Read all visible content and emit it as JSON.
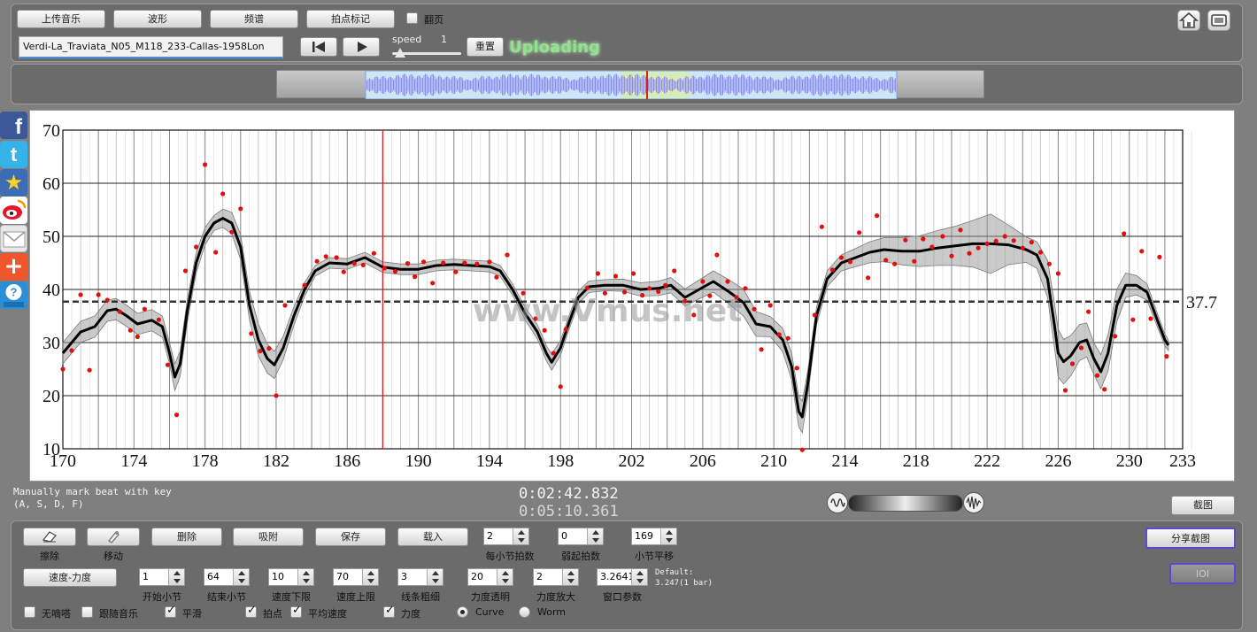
{
  "toolbar": {
    "upload_music": "上传音乐",
    "waveform": "波形",
    "spectrum": "频谱",
    "beat_mark": "拍点标记",
    "page_turn": "翻页",
    "file_name": "Verdi-La_Traviata_N05_M118_233-Callas-1958Lon",
    "speed_label": "speed",
    "speed_value": "1",
    "speed_level": 0.12,
    "reset": "重置",
    "status": "Uploading"
  },
  "overview": {
    "view_start": 0.0,
    "view_end": 1.0,
    "selection_start": 0.48,
    "selection_end": 0.61,
    "playhead": 0.53
  },
  "watermark": "www.Vmus.net",
  "chart_data": {
    "type": "line",
    "x_ticks": [
      "170",
      "174",
      "178",
      "182",
      "186",
      "190",
      "194",
      "198",
      "202",
      "206",
      "210",
      "214",
      "218",
      "222",
      "226",
      "230",
      "233"
    ],
    "y_ticks": [
      "10",
      "20",
      "30",
      "40",
      "50",
      "60",
      "70"
    ],
    "xlim": [
      170,
      233
    ],
    "ylim": [
      10,
      70
    ],
    "average": 37.7,
    "average_label": "37.7",
    "cursor_x": 188,
    "grid": true,
    "smooth_curve": [
      [
        170,
        28
      ],
      [
        170.5,
        30
      ],
      [
        171,
        32
      ],
      [
        171.8,
        33
      ],
      [
        172.5,
        36
      ],
      [
        173,
        36.3
      ],
      [
        173.6,
        35
      ],
      [
        174.2,
        33.5
      ],
      [
        175,
        34.2
      ],
      [
        175.6,
        33
      ],
      [
        176,
        28
      ],
      [
        176.3,
        23.5
      ],
      [
        176.6,
        26
      ],
      [
        177,
        36
      ],
      [
        177.5,
        45
      ],
      [
        178,
        50
      ],
      [
        178.5,
        52.5
      ],
      [
        179,
        53.4
      ],
      [
        179.5,
        52.5
      ],
      [
        180,
        48
      ],
      [
        180.5,
        37
      ],
      [
        181,
        30.5
      ],
      [
        181.5,
        27
      ],
      [
        181.9,
        25.8
      ],
      [
        182.4,
        29
      ],
      [
        183,
        35
      ],
      [
        183.6,
        40
      ],
      [
        184.2,
        43.5
      ],
      [
        185,
        45
      ],
      [
        186,
        44.8
      ],
      [
        187,
        46
      ],
      [
        188,
        44.2
      ],
      [
        189,
        43.8
      ],
      [
        190,
        43.8
      ],
      [
        191,
        44.5
      ],
      [
        192,
        44.7
      ],
      [
        193,
        44.5
      ],
      [
        194,
        44.3
      ],
      [
        194.6,
        43.5
      ],
      [
        195.3,
        40
      ],
      [
        196,
        35.5
      ],
      [
        196.7,
        32
      ],
      [
        197.2,
        28
      ],
      [
        197.5,
        26.3
      ],
      [
        198,
        29
      ],
      [
        198.5,
        34
      ],
      [
        199,
        38.5
      ],
      [
        199.6,
        40.5
      ],
      [
        200.5,
        40.8
      ],
      [
        201.5,
        40.8
      ],
      [
        202.5,
        40
      ],
      [
        203.5,
        40.2
      ],
      [
        204.2,
        40.8
      ],
      [
        205,
        38.5
      ],
      [
        205.8,
        40
      ],
      [
        206.6,
        41.5
      ],
      [
        207.5,
        39.5
      ],
      [
        208.3,
        37.5
      ],
      [
        209,
        33.5
      ],
      [
        209.8,
        33
      ],
      [
        210.5,
        30.5
      ],
      [
        211,
        25.5
      ],
      [
        211.4,
        17
      ],
      [
        211.6,
        16
      ],
      [
        211.9,
        22
      ],
      [
        212.4,
        35
      ],
      [
        213,
        42
      ],
      [
        213.8,
        45
      ],
      [
        214.6,
        46
      ],
      [
        215.4,
        47
      ],
      [
        216.2,
        47.5
      ],
      [
        217.2,
        47.2
      ],
      [
        218.2,
        47.2
      ],
      [
        219.2,
        47.8
      ],
      [
        220.2,
        48.2
      ],
      [
        221.2,
        48.6
      ],
      [
        222.2,
        48.6
      ],
      [
        223.2,
        48.4
      ],
      [
        224.2,
        47.5
      ],
      [
        224.8,
        46.5
      ],
      [
        225.4,
        42
      ],
      [
        225.8,
        33
      ],
      [
        226,
        28
      ],
      [
        226.3,
        26.4
      ],
      [
        226.7,
        27.5
      ],
      [
        227.2,
        30
      ],
      [
        227.6,
        30.5
      ],
      [
        228,
        27
      ],
      [
        228.4,
        24.5
      ],
      [
        228.8,
        28
      ],
      [
        229.3,
        37
      ],
      [
        229.8,
        40.8
      ],
      [
        230.4,
        40.8
      ],
      [
        231,
        39.5
      ],
      [
        231.6,
        34
      ],
      [
        232,
        30.5
      ],
      [
        232.2,
        29.5
      ]
    ],
    "band": [
      [
        170,
        2
      ],
      [
        176,
        2
      ],
      [
        176.3,
        2.5
      ],
      [
        178.5,
        1.4
      ],
      [
        181,
        3
      ],
      [
        182,
        2.5
      ],
      [
        184,
        1
      ],
      [
        195,
        1
      ],
      [
        197.5,
        1.5
      ],
      [
        200,
        1
      ],
      [
        204,
        1.4
      ],
      [
        206,
        1.8
      ],
      [
        208.5,
        2.6
      ],
      [
        210,
        1.8
      ],
      [
        211.6,
        3
      ],
      [
        212.5,
        1.5
      ],
      [
        214,
        1.5
      ],
      [
        216,
        2.2
      ],
      [
        218,
        2.8
      ],
      [
        221,
        4
      ],
      [
        222,
        6
      ],
      [
        223,
        4
      ],
      [
        224.5,
        2
      ],
      [
        226,
        4.5
      ],
      [
        227,
        3.5
      ],
      [
        228,
        3
      ],
      [
        229,
        3.5
      ],
      [
        230,
        2
      ],
      [
        232.2,
        1
      ]
    ],
    "points": [
      [
        170,
        25
      ],
      [
        170.5,
        28.5
      ],
      [
        171,
        39
      ],
      [
        171.5,
        24.8
      ],
      [
        172,
        39
      ],
      [
        172.5,
        38
      ],
      [
        173.2,
        35.8
      ],
      [
        173.8,
        32.3
      ],
      [
        174.2,
        31.1
      ],
      [
        174.6,
        36.3
      ],
      [
        175.4,
        34.3
      ],
      [
        175.9,
        25.8
      ],
      [
        176.4,
        16.4
      ],
      [
        176.9,
        43.5
      ],
      [
        177.5,
        48
      ],
      [
        178,
        63.5
      ],
      [
        178.6,
        47
      ],
      [
        179,
        58
      ],
      [
        179.5,
        50.8
      ],
      [
        180,
        55.2
      ],
      [
        180.6,
        31.7
      ],
      [
        181.1,
        28.4
      ],
      [
        181.6,
        28.9
      ],
      [
        182,
        20
      ],
      [
        182.5,
        37
      ],
      [
        183.6,
        40.8
      ],
      [
        184.3,
        45.3
      ],
      [
        184.8,
        46.2
      ],
      [
        185.4,
        46
      ],
      [
        185.8,
        43.3
      ],
      [
        186.4,
        44.9
      ],
      [
        186.9,
        44.6
      ],
      [
        187.5,
        46.8
      ],
      [
        188.1,
        44
      ],
      [
        188.7,
        43.4
      ],
      [
        189.4,
        44.9
      ],
      [
        189.8,
        42.4
      ],
      [
        190.3,
        45.2
      ],
      [
        190.8,
        41.2
      ],
      [
        191.4,
        45
      ],
      [
        192.1,
        43.3
      ],
      [
        192.6,
        45
      ],
      [
        193.3,
        44.8
      ],
      [
        194,
        45.2
      ],
      [
        194.4,
        42.3
      ],
      [
        195,
        46.5
      ],
      [
        195.9,
        39.3
      ],
      [
        196.6,
        34.5
      ],
      [
        197.1,
        32.3
      ],
      [
        197.6,
        28
      ],
      [
        198,
        21.7
      ],
      [
        198.3,
        32.5
      ],
      [
        199.5,
        40.3
      ],
      [
        200.1,
        43
      ],
      [
        200.5,
        39.3
      ],
      [
        201.1,
        42.5
      ],
      [
        201.6,
        39.5
      ],
      [
        202.1,
        43
      ],
      [
        202.6,
        38.9
      ],
      [
        203,
        40.2
      ],
      [
        203.5,
        39.6
      ],
      [
        203.9,
        40.8
      ],
      [
        204.4,
        43.5
      ],
      [
        205,
        37.8
      ],
      [
        205.5,
        35.2
      ],
      [
        206,
        41.5
      ],
      [
        206.4,
        38.8
      ],
      [
        206.8,
        46.5
      ],
      [
        207.4,
        41.5
      ],
      [
        207.9,
        38.5
      ],
      [
        208.4,
        40.2
      ],
      [
        208.9,
        36.3
      ],
      [
        209.3,
        28.7
      ],
      [
        209.8,
        37
      ],
      [
        210.3,
        31.5
      ],
      [
        210.8,
        30.8
      ],
      [
        211.3,
        25.2
      ],
      [
        211.6,
        9.8
      ],
      [
        212.3,
        35.2
      ],
      [
        212.7,
        51.8
      ],
      [
        213.3,
        43.7
      ],
      [
        213.8,
        46
      ],
      [
        214.3,
        45.2
      ],
      [
        214.8,
        50.7
      ],
      [
        215.3,
        42.2
      ],
      [
        215.8,
        53.9
      ],
      [
        216.3,
        45.5
      ],
      [
        216.8,
        44.8
      ],
      [
        217.4,
        49.3
      ],
      [
        217.9,
        45.3
      ],
      [
        218.4,
        49.5
      ],
      [
        218.9,
        48
      ],
      [
        219.5,
        50
      ],
      [
        220,
        46.3
      ],
      [
        220.5,
        51.2
      ],
      [
        221,
        46.8
      ],
      [
        221.5,
        47.8
      ],
      [
        222,
        48.6
      ],
      [
        222.5,
        49.1
      ],
      [
        223,
        50
      ],
      [
        223.5,
        49.2
      ],
      [
        224,
        47.8
      ],
      [
        224.5,
        48.9
      ],
      [
        225,
        47
      ],
      [
        225.5,
        44.8
      ],
      [
        226,
        43
      ],
      [
        226.4,
        21
      ],
      [
        226.8,
        26
      ],
      [
        227.3,
        29
      ],
      [
        227.7,
        35.8
      ],
      [
        228.2,
        23.8
      ],
      [
        228.6,
        21.2
      ],
      [
        229.2,
        31.2
      ],
      [
        229.7,
        50.5
      ],
      [
        230.2,
        34.3
      ],
      [
        230.7,
        47.2
      ],
      [
        231.2,
        34.5
      ],
      [
        231.7,
        46.1
      ],
      [
        232.1,
        27.4
      ]
    ]
  },
  "info": {
    "hint_line1": "Manually mark beat with key",
    "hint_line2": "(A, S, D, F)",
    "time_current": "0:02:42.832",
    "time_total": "0:05:10.361",
    "screenshot": "截图",
    "volume_level": 0.5
  },
  "controls": {
    "erase": "擦除",
    "move": "移动",
    "delete": "删除",
    "snap": "吸附",
    "save": "保存",
    "load": "载入",
    "beats_per_bar_value": "2",
    "beats_per_bar": "每小节拍数",
    "pickup_value": "0",
    "pickup": "弱起拍数",
    "bar_offset_value": "169",
    "bar_offset": "小节平移",
    "share_screenshot": "分享截图",
    "ioi": "IOI",
    "tempo_dynamics": "速度-力度",
    "start_bar_value": "1",
    "start_bar": "开始小节",
    "end_bar_value": "64",
    "end_bar": "结束小节",
    "tempo_min_value": "10",
    "tempo_min": "速度下限",
    "tempo_max_value": "70",
    "tempo_max": "速度上限",
    "line_width_value": "3",
    "line_width": "线条粗细",
    "dyn_alpha_value": "20",
    "dyn_alpha": "力度透明",
    "dyn_scale_value": "2",
    "dyn_scale": "力度放大",
    "window_value": "3.2641",
    "window": "窗口参数",
    "default_line1": "Default:",
    "default_line2": "3.247(1 bar)",
    "no_click": "无嘀嗒",
    "follow_music": "跟随音乐",
    "smooth": "平滑",
    "beat_points": "拍点",
    "avg_tempo": "平均速度",
    "dynamics": "力度",
    "curve": "Curve",
    "worm": "Worm"
  },
  "colors": {
    "panel": "#6b6b6b",
    "status_green": "#7fe07a",
    "cursor_red": "#d42020",
    "point_red": "#e01010",
    "wave_blue": "#8d8df0"
  }
}
